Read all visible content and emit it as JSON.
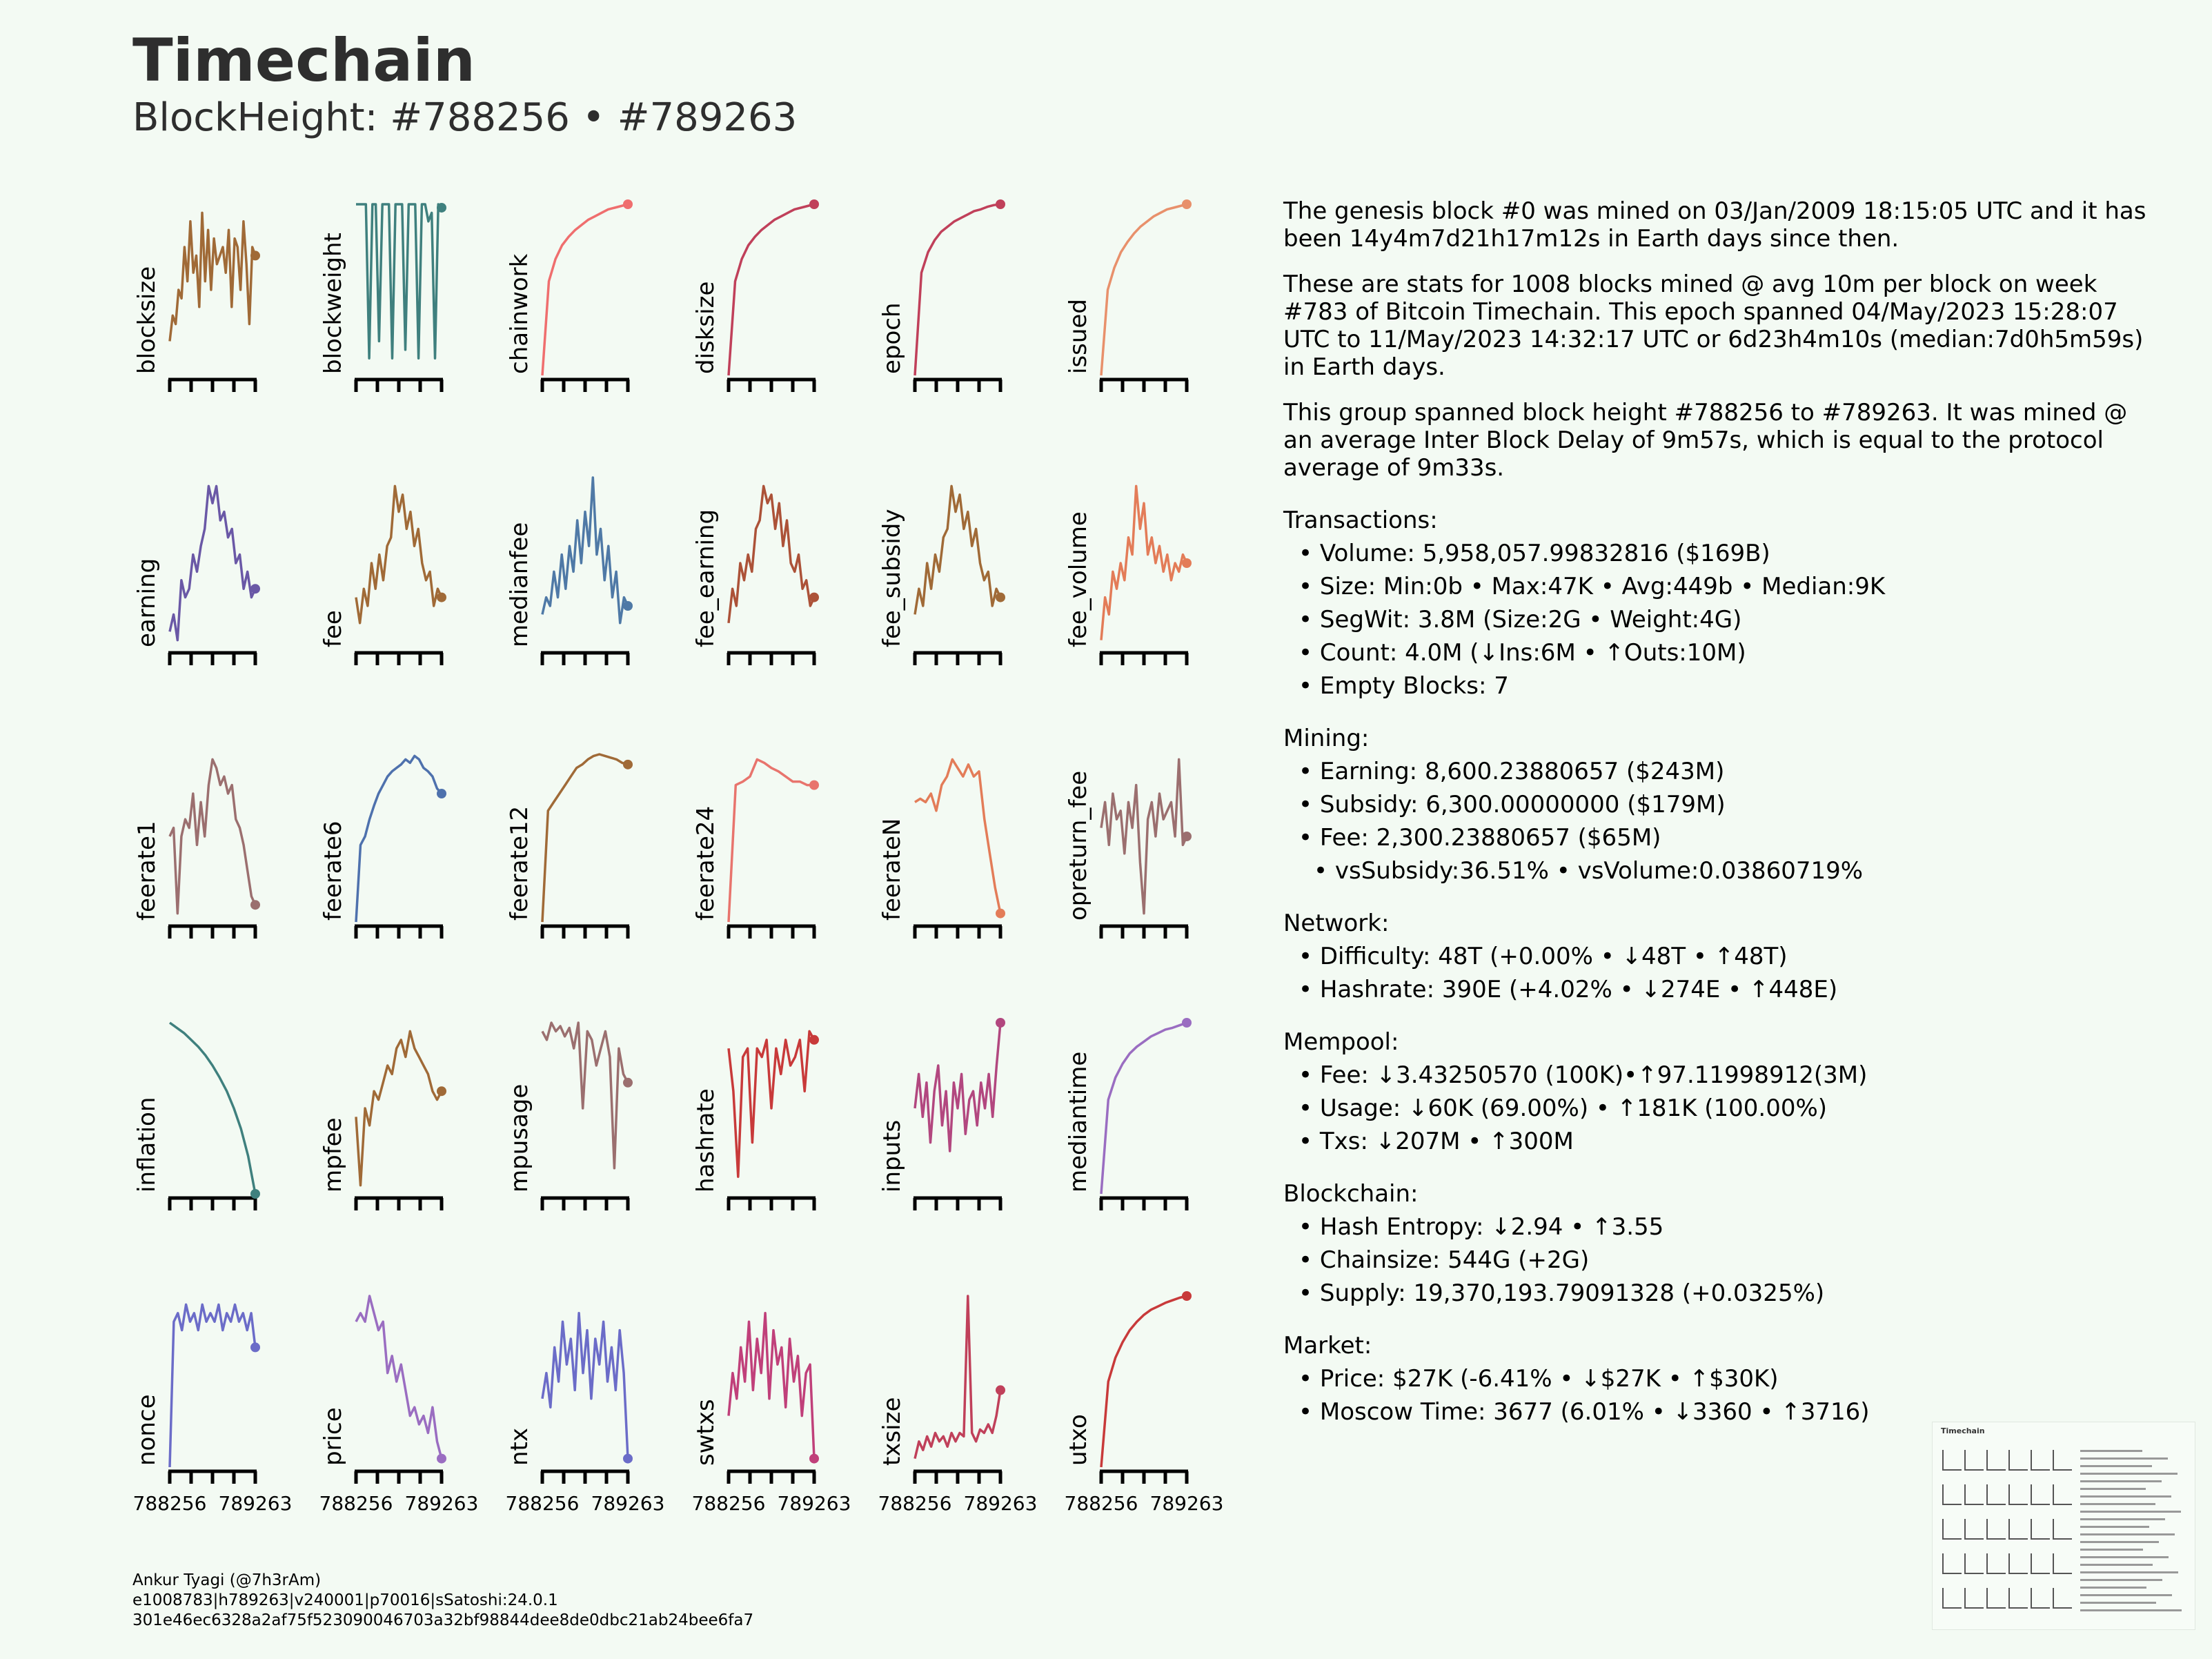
{
  "header": {
    "title": "Timechain",
    "subtitle": "BlockHeight: #788256 • #789263"
  },
  "colors": {
    "brown": "#a06a37",
    "teal": "#3f807e",
    "salmon": "#ef6e6e",
    "crimson": "#c0405a",
    "orange": "#e8906b",
    "purple": "#6a58a6",
    "steel": "#4f79a6",
    "rust": "#ac5238",
    "orangered": "#e37c58",
    "mauve": "#9b6f6f",
    "blue": "#4e71ad",
    "coral": "#e8746d",
    "lavender": "#9a6dc1",
    "red": "#c83a3a",
    "magenta": "#b2477f",
    "indigo": "#6b6cc8",
    "pink": "#c0407a"
  },
  "chart_data": {
    "type": "line",
    "x_range": [
      788256,
      789263
    ],
    "x_tick_labels": [
      "788256",
      "789263"
    ],
    "panels": [
      {
        "name": "blocksize",
        "color": "brown",
        "values": [
          0.2,
          0.35,
          0.3,
          0.5,
          0.45,
          0.75,
          0.55,
          0.9,
          0.6,
          0.7,
          0.4,
          0.95,
          0.55,
          0.85,
          0.5,
          0.8,
          0.65,
          0.7,
          0.75,
          0.6,
          0.85,
          0.4,
          0.8,
          0.75,
          0.5,
          0.9,
          0.65,
          0.3,
          0.75,
          0.7
        ]
      },
      {
        "name": "blockweight",
        "color": "teal",
        "values": [
          1,
          1,
          1,
          1,
          0.1,
          1,
          1,
          0.2,
          1,
          1,
          1,
          0.1,
          1,
          1,
          1,
          0.15,
          1,
          1,
          1,
          0.1,
          1,
          1,
          0.9,
          0.95,
          0.1,
          1,
          0.98
        ]
      },
      {
        "name": "chainwork",
        "color": "salmon",
        "values": [
          0,
          0.55,
          0.68,
          0.76,
          0.81,
          0.85,
          0.88,
          0.91,
          0.93,
          0.95,
          0.97,
          0.98,
          0.99,
          1
        ]
      },
      {
        "name": "disksize",
        "color": "crimson",
        "values": [
          0,
          0.55,
          0.68,
          0.76,
          0.81,
          0.85,
          0.88,
          0.91,
          0.93,
          0.95,
          0.97,
          0.98,
          0.99,
          1
        ]
      },
      {
        "name": "epoch",
        "color": "crimson",
        "values": [
          0,
          0.6,
          0.72,
          0.79,
          0.84,
          0.87,
          0.9,
          0.92,
          0.94,
          0.96,
          0.97,
          0.985,
          0.995,
          1
        ]
      },
      {
        "name": "issued",
        "color": "orange",
        "values": [
          0,
          0.5,
          0.63,
          0.72,
          0.78,
          0.83,
          0.87,
          0.9,
          0.93,
          0.95,
          0.97,
          0.98,
          0.99,
          1
        ]
      },
      {
        "name": "earning",
        "color": "purple",
        "values": [
          0.1,
          0.2,
          0.05,
          0.4,
          0.3,
          0.35,
          0.55,
          0.45,
          0.6,
          0.7,
          0.95,
          0.85,
          0.95,
          0.75,
          0.8,
          0.65,
          0.7,
          0.5,
          0.55,
          0.35,
          0.45,
          0.3,
          0.35
        ]
      },
      {
        "name": "fee",
        "color": "brown",
        "values": [
          0.3,
          0.15,
          0.35,
          0.25,
          0.5,
          0.35,
          0.55,
          0.4,
          0.6,
          0.65,
          0.95,
          0.8,
          0.9,
          0.7,
          0.8,
          0.6,
          0.7,
          0.5,
          0.4,
          0.45,
          0.25,
          0.35,
          0.3
        ]
      },
      {
        "name": "medianfee",
        "color": "steel",
        "values": [
          0.2,
          0.3,
          0.25,
          0.45,
          0.3,
          0.55,
          0.35,
          0.6,
          0.45,
          0.75,
          0.5,
          0.8,
          0.6,
          1,
          0.55,
          0.7,
          0.4,
          0.6,
          0.3,
          0.45,
          0.15,
          0.3,
          0.25
        ]
      },
      {
        "name": "fee_earning",
        "color": "rust",
        "values": [
          0.15,
          0.35,
          0.25,
          0.5,
          0.4,
          0.55,
          0.45,
          0.7,
          0.75,
          0.95,
          0.85,
          0.9,
          0.7,
          0.85,
          0.6,
          0.75,
          0.5,
          0.45,
          0.55,
          0.35,
          0.4,
          0.25,
          0.3
        ]
      },
      {
        "name": "fee_subsidy",
        "color": "brown",
        "values": [
          0.2,
          0.35,
          0.25,
          0.5,
          0.35,
          0.55,
          0.45,
          0.65,
          0.7,
          0.95,
          0.8,
          0.9,
          0.7,
          0.8,
          0.6,
          0.7,
          0.5,
          0.4,
          0.45,
          0.25,
          0.35,
          0.3
        ]
      },
      {
        "name": "fee_volume",
        "color": "orangered",
        "values": [
          0.05,
          0.3,
          0.2,
          0.45,
          0.35,
          0.5,
          0.4,
          0.65,
          0.55,
          0.95,
          0.7,
          0.85,
          0.55,
          0.65,
          0.5,
          0.6,
          0.45,
          0.55,
          0.4,
          0.5,
          0.45,
          0.55,
          0.5
        ]
      },
      {
        "name": "feerate1",
        "color": "mauve",
        "values": [
          0.5,
          0.55,
          0.05,
          0.5,
          0.6,
          0.55,
          0.75,
          0.45,
          0.7,
          0.5,
          0.8,
          0.95,
          0.9,
          0.8,
          0.85,
          0.75,
          0.8,
          0.6,
          0.55,
          0.45,
          0.3,
          0.15,
          0.1
        ]
      },
      {
        "name": "feerate6",
        "color": "blue",
        "values": [
          0,
          0.45,
          0.5,
          0.6,
          0.68,
          0.75,
          0.8,
          0.85,
          0.88,
          0.9,
          0.92,
          0.95,
          0.93,
          0.97,
          0.95,
          0.9,
          0.88,
          0.85,
          0.78,
          0.75
        ]
      },
      {
        "name": "feerate12",
        "color": "brown",
        "values": [
          0,
          0.65,
          0.7,
          0.75,
          0.8,
          0.85,
          0.9,
          0.92,
          0.95,
          0.97,
          0.98,
          0.97,
          0.96,
          0.95,
          0.93,
          0.92
        ]
      },
      {
        "name": "feerate24",
        "color": "coral",
        "values": [
          0,
          0.8,
          0.82,
          0.85,
          0.95,
          0.93,
          0.9,
          0.88,
          0.85,
          0.82,
          0.82,
          0.8,
          0.8
        ]
      },
      {
        "name": "feerateN",
        "color": "orangered",
        "values": [
          0.7,
          0.72,
          0.7,
          0.75,
          0.65,
          0.8,
          0.85,
          0.95,
          0.9,
          0.85,
          0.92,
          0.85,
          0.88,
          0.6,
          0.4,
          0.2,
          0.05
        ]
      },
      {
        "name": "opreturn_fee",
        "color": "mauve",
        "values": [
          0.55,
          0.7,
          0.45,
          0.75,
          0.6,
          0.65,
          0.4,
          0.7,
          0.55,
          0.8,
          0.35,
          0.05,
          0.6,
          0.7,
          0.5,
          0.75,
          0.6,
          0.65,
          0.7,
          0.5,
          0.95,
          0.45,
          0.5
        ]
      },
      {
        "name": "inflation",
        "color": "teal",
        "values": [
          1,
          0.97,
          0.94,
          0.9,
          0.86,
          0.81,
          0.75,
          0.68,
          0.6,
          0.5,
          0.38,
          0.22,
          0
        ]
      },
      {
        "name": "mpfee",
        "color": "brown",
        "values": [
          0.45,
          0.05,
          0.5,
          0.4,
          0.6,
          0.55,
          0.65,
          0.75,
          0.7,
          0.85,
          0.9,
          0.8,
          0.95,
          0.85,
          0.8,
          0.75,
          0.7,
          0.6,
          0.55,
          0.6
        ]
      },
      {
        "name": "mpusage",
        "color": "mauve",
        "values": [
          0.95,
          0.9,
          1,
          0.95,
          0.98,
          0.92,
          0.97,
          0.85,
          1,
          0.5,
          0.95,
          0.9,
          0.75,
          0.85,
          0.95,
          0.8,
          0.15,
          0.85,
          0.7,
          0.65
        ]
      },
      {
        "name": "hashrate",
        "color": "red",
        "values": [
          0.85,
          0.6,
          0.1,
          0.8,
          0.85,
          0.3,
          0.85,
          0.8,
          0.9,
          0.5,
          0.85,
          0.7,
          0.9,
          0.75,
          0.8,
          0.9,
          0.6,
          0.95,
          0.9
        ]
      },
      {
        "name": "inputs",
        "color": "magenta",
        "values": [
          0.5,
          0.7,
          0.45,
          0.65,
          0.3,
          0.6,
          0.75,
          0.4,
          0.6,
          0.25,
          0.65,
          0.5,
          0.7,
          0.35,
          0.55,
          0.6,
          0.4,
          0.65,
          0.5,
          0.7,
          0.45,
          0.75,
          1
        ]
      },
      {
        "name": "mediantime",
        "color": "lavender",
        "values": [
          0,
          0.55,
          0.68,
          0.76,
          0.82,
          0.86,
          0.89,
          0.92,
          0.94,
          0.96,
          0.97,
          0.985,
          1
        ]
      },
      {
        "name": "nonce",
        "color": "indigo",
        "values": [
          0,
          0.85,
          0.9,
          0.8,
          0.95,
          0.85,
          0.9,
          0.8,
          0.95,
          0.85,
          0.9,
          0.85,
          0.95,
          0.8,
          0.9,
          0.85,
          0.95,
          0.85,
          0.9,
          0.8,
          0.9,
          0.7
        ]
      },
      {
        "name": "price",
        "color": "lavender",
        "values": [
          0.85,
          0.9,
          0.85,
          1,
          0.9,
          0.8,
          0.85,
          0.55,
          0.65,
          0.5,
          0.6,
          0.45,
          0.3,
          0.35,
          0.25,
          0.3,
          0.2,
          0.35,
          0.15,
          0.05
        ]
      },
      {
        "name": "ntx",
        "color": "indigo",
        "values": [
          0.4,
          0.55,
          0.35,
          0.7,
          0.5,
          0.85,
          0.6,
          0.75,
          0.45,
          0.9,
          0.55,
          0.8,
          0.4,
          0.75,
          0.6,
          0.85,
          0.5,
          0.7,
          0.45,
          0.8,
          0.55,
          0.05
        ]
      },
      {
        "name": "swtxs",
        "color": "pink",
        "values": [
          0.3,
          0.55,
          0.4,
          0.7,
          0.5,
          0.85,
          0.45,
          0.75,
          0.55,
          0.9,
          0.4,
          0.8,
          0.6,
          0.7,
          0.35,
          0.75,
          0.5,
          0.65,
          0.3,
          0.55,
          0.6,
          0.05
        ]
      },
      {
        "name": "txsize",
        "color": "crimson",
        "values": [
          0.05,
          0.15,
          0.1,
          0.18,
          0.12,
          0.2,
          0.15,
          0.18,
          0.12,
          0.2,
          0.15,
          0.2,
          0.18,
          1,
          0.2,
          0.15,
          0.22,
          0.2,
          0.25,
          0.2,
          0.3,
          0.45
        ]
      },
      {
        "name": "utxo",
        "color": "red",
        "values": [
          0,
          0.5,
          0.64,
          0.73,
          0.8,
          0.85,
          0.89,
          0.92,
          0.94,
          0.96,
          0.975,
          0.99,
          1
        ]
      }
    ]
  },
  "stats": {
    "intro1": "The genesis block #0 was mined on 03/Jan/2009 18:15:05 UTC and it has been 14y4m7d21h17m12s in Earth days since then.",
    "intro2": "These are stats for 1008 blocks mined @ avg 10m per block on week #783 of Bitcoin Timechain. This epoch spanned 04/May/2023 15:28:07 UTC to 11/May/2023 14:32:17 UTC or 6d23h4m10s (median:7d0h5m59s) in Earth days.",
    "intro3": "This group spanned block height #788256 to #789263. It was mined @ an average Inter Block Delay of 9m57s, which is equal to the protocol average of 9m33s.",
    "transactions": {
      "heading": "Transactions:",
      "volume": "• Volume: 5,958,057.99832816 ($169B)",
      "size": "• Size: Min:0b • Max:47K • Avg:449b • Median:9K",
      "segwit": "• SegWit: 3.8M (Size:2G • Weight:4G)",
      "count": "• Count: 4.0M (↓Ins:6M • ↑Outs:10M)",
      "empty": "• Empty Blocks: 7"
    },
    "mining": {
      "heading": "Mining:",
      "earning": "• Earning: 8,600.23880657 ($243M)",
      "subsidy": "• Subsidy: 6,300.00000000 ($179M)",
      "fee": "• Fee: 2,300.23880657 ($65M)",
      "ratio": "• vsSubsidy:36.51% • vsVolume:0.03860719%"
    },
    "network": {
      "heading": "Network:",
      "difficulty": "• Difficulty: 48T (+0.00% • ↓48T • ↑48T)",
      "hashrate": "• Hashrate: 390E (+4.02% • ↓274E • ↑448E)"
    },
    "mempool": {
      "heading": "Mempool:",
      "fee": "• Fee: ↓3.43250570 (100K)•↑97.11998912(3M)",
      "usage": "• Usage: ↓60K (69.00%) • ↑181K (100.00%)",
      "txs": "• Txs: ↓207M • ↑300M"
    },
    "blockchain": {
      "heading": "Blockchain:",
      "entropy": "• Hash Entropy: ↓2.94 • ↑3.55",
      "chainsize": "• Chainsize: 544G (+2G)",
      "supply": "• Supply: 19,370,193.79091328 (+0.0325%)"
    },
    "market": {
      "heading": "Market:",
      "price": "• Price: $27K (-6.41% • ↓$27K • ↑$30K)",
      "moscow": "• Moscow Time: 3677 (6.01% • ↓3360 • ↑3716)"
    }
  },
  "footer": {
    "author": "Ankur Tyagi (@7h3rAm)",
    "build": "e1008783|h789263|v240001|p70016|sSatoshi:24.0.1",
    "hash": "301e46ec6328a2af75f523090046703a32bf98844dee8de0dbc21ab24bee6fa7"
  },
  "thumbnail": {
    "title": "Timechain"
  }
}
